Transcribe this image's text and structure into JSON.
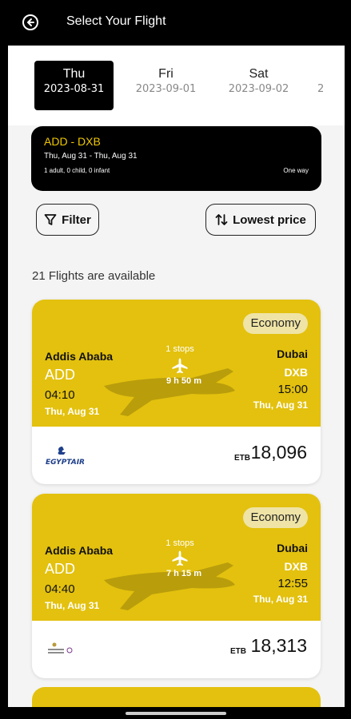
{
  "header": {
    "title": "Select Your Flight",
    "back_icon": "back-arrow-circle-icon"
  },
  "date_tabs": [
    {
      "day": "Thu",
      "date": "2023-08-31",
      "selected": true
    },
    {
      "day": "Fri",
      "date": "2023-09-01",
      "selected": false
    },
    {
      "day": "Sat",
      "date": "2023-09-02",
      "selected": false
    }
  ],
  "date_tab_partial": "2",
  "route": {
    "code": "ADD - DXB",
    "dates": "Thu, Aug 31 - Thu, Aug 31",
    "passengers": "1 adult, 0 child, 0 infant",
    "trip_type": "One way"
  },
  "filter": {
    "label": "Filter",
    "icon": "filter-funnel-icon"
  },
  "sort": {
    "label": "Lowest price",
    "icon": "sort-arrows-icon"
  },
  "results_count": "21 Flights are available",
  "flights": [
    {
      "cabin": "Economy",
      "from_city": "Addis Ababa",
      "from_code": "ADD",
      "depart_time": "04:10",
      "depart_date": "Thu, Aug 31",
      "stops": "1 stops",
      "duration": "9 h 50 m",
      "to_city": "Dubai",
      "to_code": "DXB",
      "arrive_time": "15:00",
      "arrive_date": "Thu, Aug 31",
      "airline_logo_text": "EGYPTAIR",
      "currency": "ETB",
      "price": "18,096"
    },
    {
      "cabin": "Economy",
      "from_city": "Addis Ababa",
      "from_code": "ADD",
      "depart_time": "04:40",
      "depart_date": "Thu, Aug 31",
      "stops": "1 stops",
      "duration": "7 h 15 m",
      "to_city": "Dubai",
      "to_code": "DXB",
      "arrive_time": "12:55",
      "arrive_date": "Thu, Aug 31",
      "airline_logo_text": "",
      "currency": "ETB",
      "price": "18,313"
    }
  ],
  "colors": {
    "accent": "#e3c10e",
    "route_code": "#f0c800",
    "dark": "#000000",
    "cabin_badge": "#efe4a6"
  }
}
